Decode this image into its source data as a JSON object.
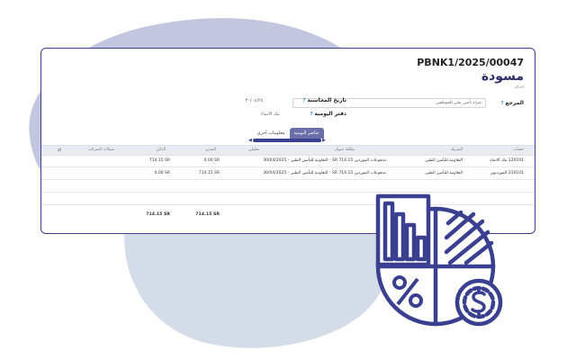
{
  "document": {
    "reference": "PBNK1/2025/00047",
    "status": "مسودة",
    "status_sub": "الحالة"
  },
  "fields": {
    "ref_label": "المرجع",
    "ref_value": "شراء تأمين طبي للموظفين",
    "date_label": "تاريخ المحاسبة",
    "date_value": "٣٠/٠٤/٢٥",
    "journal_label": "دفتر اليومية",
    "journal_value": "بنك الانماء"
  },
  "tabs": [
    {
      "label": "عناصر اليومية",
      "active": true
    },
    {
      "label": "معلومات أخرى",
      "active": false
    }
  ],
  "table": {
    "headers": [
      "حساب",
      "الشريك",
      "بطاقة عنوان",
      "تحليلي",
      "المدين",
      "الدائن",
      "شبكات الضرائب"
    ],
    "rows": [
      [
        "120101 بنك الانماء",
        "التعاونية للتأمين الطبي",
        "مدفوعات الموردين 714.15 SR - التعاونية للتأمين الطبي - 30/04/2025",
        "",
        "0.00 SR",
        "714.15 SR",
        ""
      ],
      [
        "210101 المورديون",
        "التعاونية للتأمين الطبي",
        "مدفوعات الموردين 714.15 SR - التعاونية للتأمين الطبي - 30/04/2025",
        "",
        "714.15 SR",
        "0.00 SR",
        ""
      ]
    ],
    "total_debit": "714.15 SR",
    "total_credit": "714.15 SR"
  },
  "colors": {
    "accent": "#3a3f8f",
    "blob_back": "#c3c6df",
    "blob_front": "#d4dde7",
    "tab_active": "#6b6fa8"
  },
  "icons": [
    "finance-pie-chart-icon",
    "percent-icon",
    "dollar-coin-icon",
    "sort-columns-icon"
  ]
}
